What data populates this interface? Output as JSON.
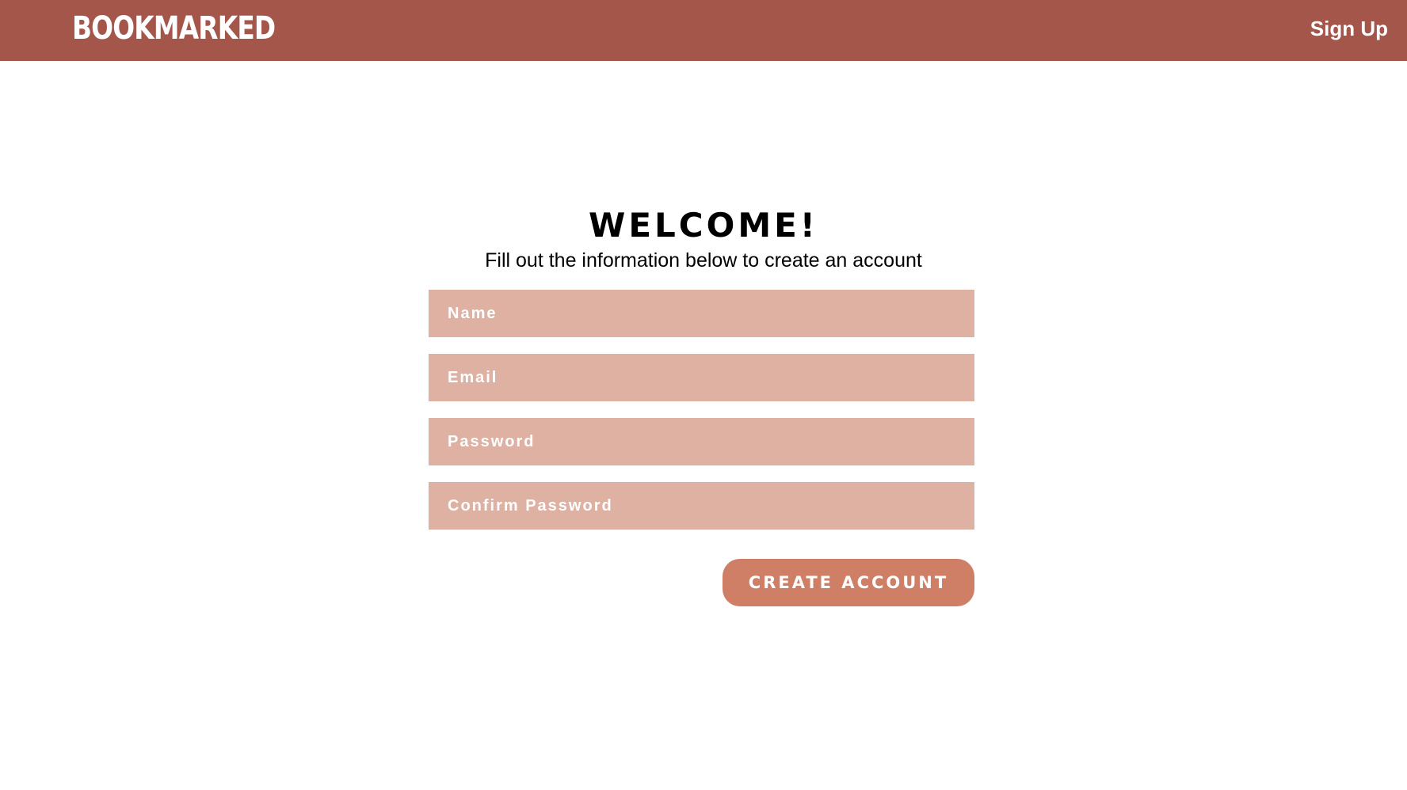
{
  "header": {
    "logo_text": "BOOKMARKED",
    "signup_label": "Sign Up"
  },
  "main": {
    "title": "WELCOME!",
    "subtitle": "Fill out the information below to create an account",
    "fields": [
      {
        "placeholder": "Name",
        "value": ""
      },
      {
        "placeholder": "Email",
        "value": ""
      },
      {
        "placeholder": "Password",
        "value": ""
      },
      {
        "placeholder": "Confirm Password",
        "value": ""
      }
    ],
    "submit_label": "CREATE ACCOUNT"
  },
  "colors": {
    "header_bg": "#a4564a",
    "field_bg": "#dfb1a2",
    "button_bg": "#cf7f66"
  }
}
